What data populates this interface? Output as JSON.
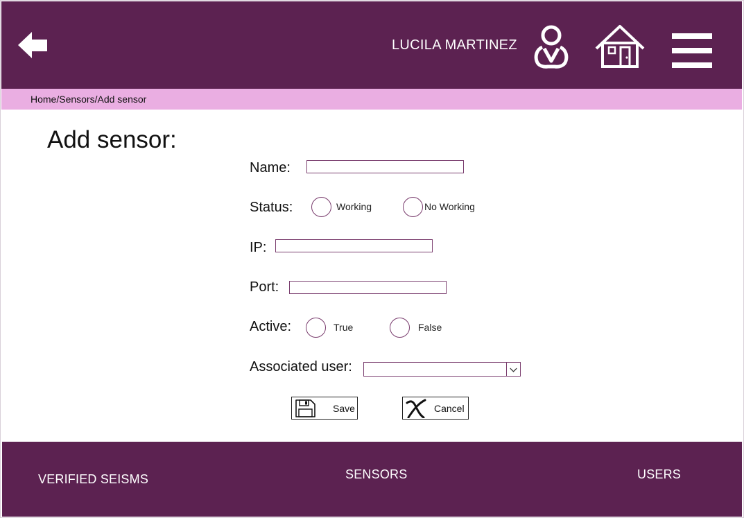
{
  "header": {
    "user_name": "LUCILA MARTINEZ",
    "background": "#5c2251",
    "icons": [
      "arrow-left-icon",
      "user-icon",
      "home-icon",
      "hamburger-menu-icon"
    ]
  },
  "breadcrumb": {
    "text": "Home/Sensors/Add sensor",
    "background": "#eaaee2"
  },
  "page": {
    "title": "Add sensor:"
  },
  "form": {
    "name": {
      "label": "Name:",
      "value": ""
    },
    "status": {
      "label": "Status:",
      "options": [
        "Working",
        "No Working"
      ],
      "selected": null
    },
    "ip": {
      "label": "IP:",
      "value": ""
    },
    "port": {
      "label": "Port:",
      "value": ""
    },
    "active": {
      "label": "Active:",
      "options": [
        "True",
        "False"
      ],
      "selected": null
    },
    "associated_user": {
      "label": "Associated user:",
      "value": ""
    }
  },
  "actions": {
    "save_label": "Save",
    "cancel_label": "Cancel"
  },
  "footer": {
    "items": [
      "VERIFIED SEISMS",
      "SENSORS",
      "USERS"
    ]
  }
}
